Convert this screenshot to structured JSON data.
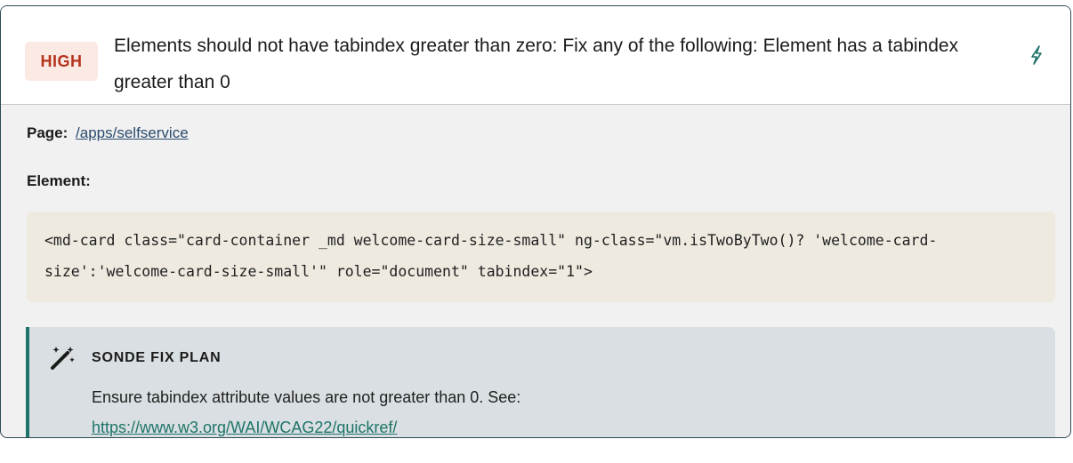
{
  "issue": {
    "severity": "HIGH",
    "title": "Elements should not have tabindex greater than zero: Fix any of the following: Element has a tabindex greater than 0",
    "fix_icon": "lightning-bolt-icon"
  },
  "details": {
    "page_label": "Page:",
    "page_link": "/apps/selfservice",
    "element_label": "Element:",
    "element_code": "<md-card class=\"card-container _md welcome-card-size-small\" ng-class=\"vm.isTwoByTwo()? 'welcome-card-size':'welcome-card-size-small'\" role=\"document\" tabindex=\"1\">"
  },
  "fix_plan": {
    "icon": "magic-wand-icon",
    "heading": "SONDE FIX PLAN",
    "text": "Ensure tabindex attribute values are not greater than 0. See:",
    "link": "https://www.w3.org/WAI/WCAG22/quickref/"
  },
  "colors": {
    "severity_text": "#b5341d",
    "severity_bg": "#fbe9e4",
    "accent": "#1e7468",
    "border": "#2f4a55"
  }
}
